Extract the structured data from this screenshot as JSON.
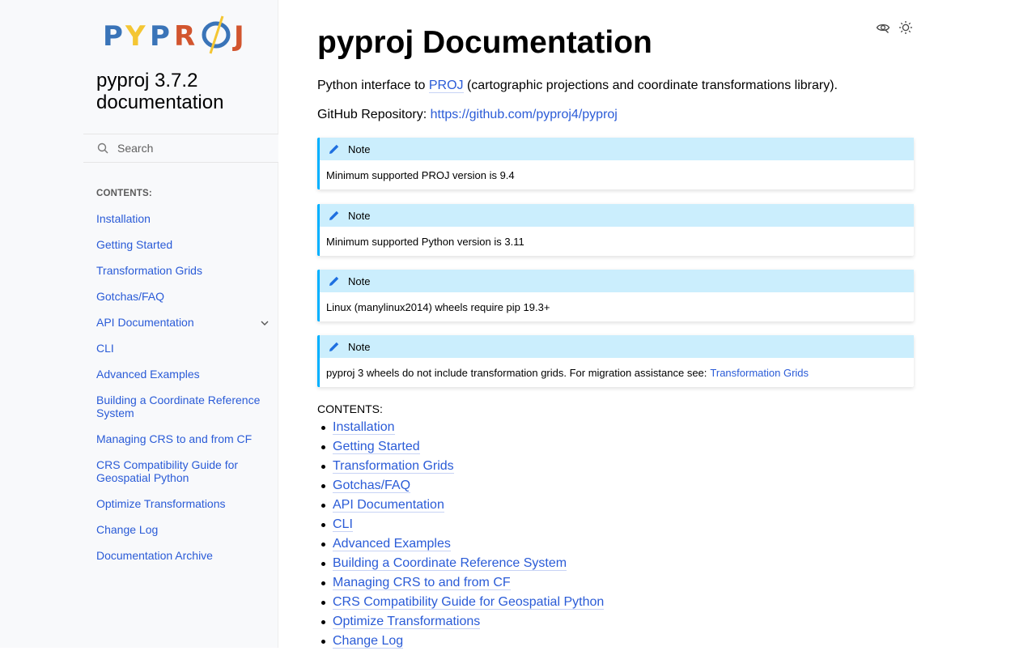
{
  "sidebar": {
    "logo_text": "PYPROJ",
    "project_title": "pyproj 3.7.2 documentation",
    "search_placeholder": "Search",
    "caption": "CONTENTS:",
    "items": [
      {
        "label": "Installation"
      },
      {
        "label": "Getting Started"
      },
      {
        "label": "Transformation Grids"
      },
      {
        "label": "Gotchas/FAQ"
      },
      {
        "label": "API Documentation",
        "expandable": true
      },
      {
        "label": "CLI"
      },
      {
        "label": "Advanced Examples"
      },
      {
        "label": "Building a Coordinate Reference System"
      },
      {
        "label": "Managing CRS to and from CF"
      },
      {
        "label": "CRS Compatibility Guide for Geospatial Python"
      },
      {
        "label": "Optimize Transformations"
      },
      {
        "label": "Change Log"
      },
      {
        "label": "Documentation Archive"
      }
    ]
  },
  "main": {
    "title": "pyproj Documentation",
    "intro_prefix": "Python interface to ",
    "intro_link": "PROJ",
    "intro_suffix": " (cartographic projections and coordinate transformations library).",
    "repo_label": "GitHub Repository: ",
    "repo_link": "https://github.com/pyproj4/pyproj",
    "notes": [
      {
        "title": "Note",
        "body": "Minimum supported PROJ version is 9.4"
      },
      {
        "title": "Note",
        "body": "Minimum supported Python version is 3.11"
      },
      {
        "title": "Note",
        "body": "Linux (manylinux2014) wheels require pip 19.3+"
      },
      {
        "title": "Note",
        "body": "pyproj 3 wheels do not include transformation grids. For migration assistance see:",
        "link": "Transformation Grids"
      }
    ],
    "contents_caption": "CONTENTS:",
    "contents": [
      "Installation",
      "Getting Started",
      "Transformation Grids",
      "Gotchas/FAQ",
      "API Documentation",
      "CLI",
      "Advanced Examples",
      "Building a Coordinate Reference System",
      "Managing CRS to and from CF",
      "CRS Compatibility Guide for Geospatial Python",
      "Optimize Transformations",
      "Change Log"
    ]
  },
  "icons": {
    "view_source": "eye-icon",
    "theme_toggle": "sun-icon",
    "search": "search-icon",
    "note": "pencil-icon",
    "expand": "chevron-down-icon"
  },
  "colors": {
    "link": "#2a5bd7",
    "note_header": "#cbeefd",
    "note_border": "#00b0ff",
    "sidebar_bg": "#f8f9fb"
  }
}
